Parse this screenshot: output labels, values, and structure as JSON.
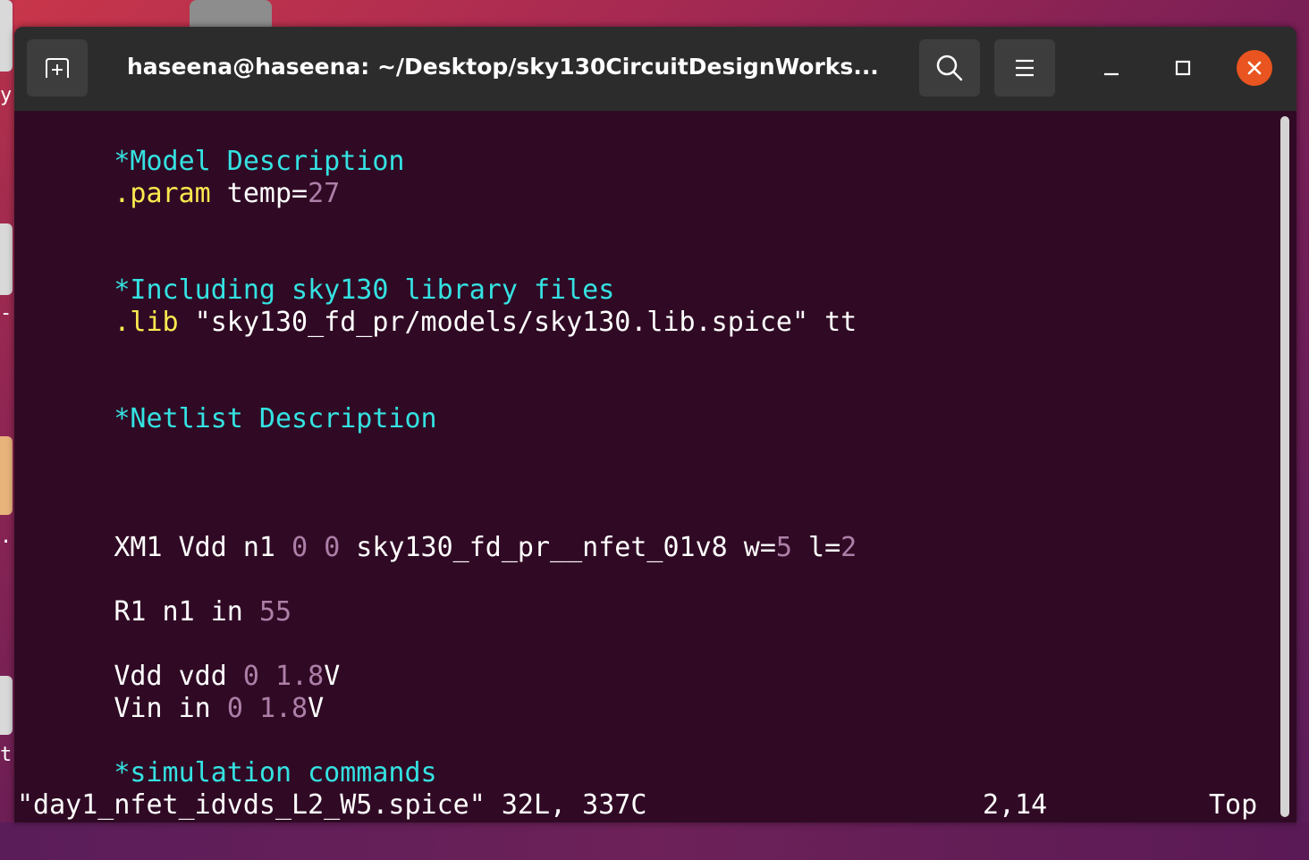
{
  "window": {
    "title": "haseena@haseena: ~/Desktop/sky130CircuitDesignWorks..."
  },
  "icons": {
    "new_tab": "new-tab-icon",
    "search": "search-icon",
    "menu": "hamburger-menu-icon",
    "minimize": "minimize-icon",
    "maximize": "maximize-icon",
    "close": "close-icon"
  },
  "colors": {
    "terminal_bg": "#300a24",
    "titlebar_bg": "#2c2c2c",
    "comment": "#34e2e2",
    "number": "#ad7fa8",
    "keyword": "#fce94f",
    "text": "#ffffff",
    "close_button": "#e95420"
  },
  "desktop": {
    "letters": [
      "y",
      "-",
      ".",
      "t"
    ]
  },
  "editor": {
    "lines": {
      "l1": {
        "comment": "*Model Description"
      },
      "l2": {
        "kw": ".param",
        "text": " temp=",
        "num": "27"
      },
      "l5": {
        "comment": "*Including sky130 library files"
      },
      "l6": {
        "kw": ".lib",
        "text": " \"sky130_fd_pr/models/sky130.lib.spice\" tt"
      },
      "l9": {
        "comment": "*Netlist Description"
      },
      "l13": {
        "t1": "XM1 Vdd n1 ",
        "n1": "0",
        "sp": " ",
        "n2": "0",
        "t2": " sky130_fd_pr__nfet_01v8 w=",
        "n3": "5",
        "t3": " l=",
        "n4": "2"
      },
      "l15": {
        "t1": "R1 n1 in ",
        "n1": "55"
      },
      "l17": {
        "t1": "Vdd vdd ",
        "n1": "0",
        "sp": " ",
        "n2": "1.8",
        "t2": "V"
      },
      "l18": {
        "t1": "Vin in ",
        "n1": "0",
        "sp": " ",
        "n2": "1.8",
        "t2": "V"
      },
      "l20": {
        "comment": "*simulation commands"
      }
    },
    "status": {
      "file": "\"day1_nfet_idvds_L2_W5.spice\" 32L, 337C",
      "position": "2,14",
      "scroll": "Top"
    }
  }
}
